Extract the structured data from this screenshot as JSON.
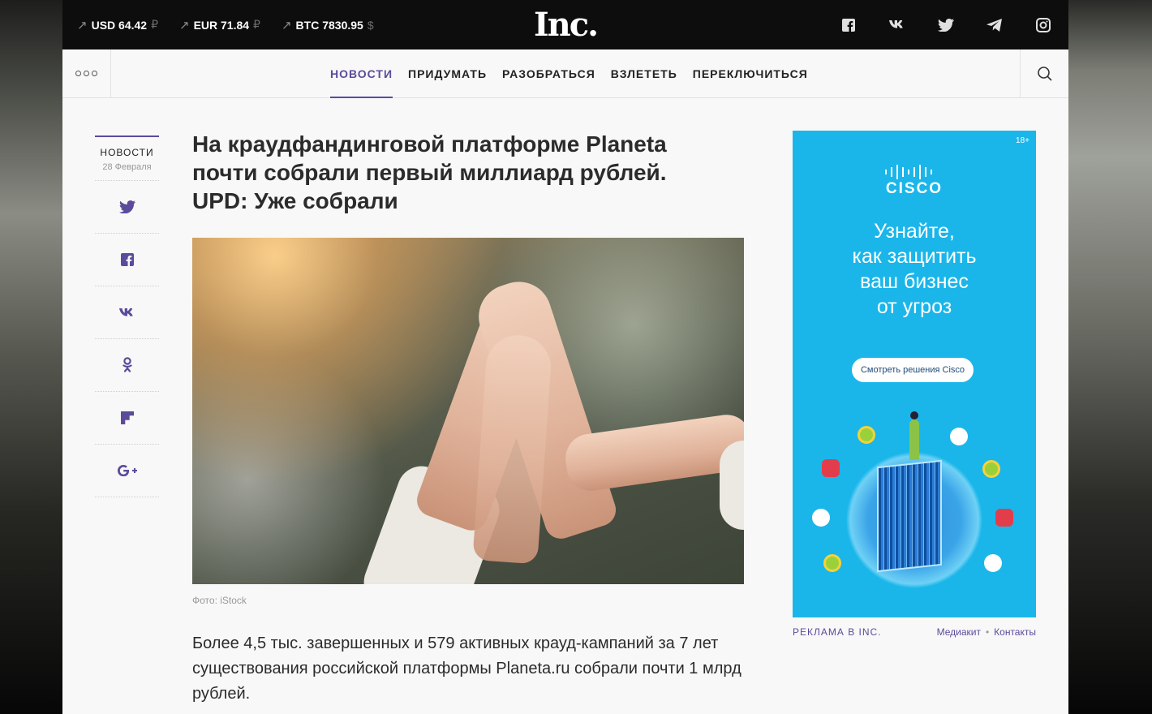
{
  "topbar": {
    "rates": [
      {
        "label": "USD 64.42",
        "currency": "₽"
      },
      {
        "label": "EUR 71.84",
        "currency": "₽"
      },
      {
        "label": "BTC 7830.95",
        "currency": "$"
      }
    ],
    "logo": "Inc.",
    "socials": [
      "facebook-icon",
      "vk-icon",
      "twitter-icon",
      "telegram-icon",
      "instagram-icon"
    ]
  },
  "nav": {
    "items": [
      "НОВОСТИ",
      "ПРИДУМАТЬ",
      "РАЗОБРАТЬСЯ",
      "ВЗЛЕТЕТЬ",
      "ПЕРЕКЛЮЧИТЬСЯ"
    ],
    "active_index": 0
  },
  "share": {
    "category": "НОВОСТИ",
    "date": "28 Февраля",
    "buttons": [
      "twitter-icon",
      "facebook-icon",
      "vk-icon",
      "odnoklassniki-icon",
      "flipboard-icon",
      "google-plus-icon"
    ]
  },
  "article": {
    "title": "На краудфандинговой платформе Planeta почти собрали первый миллиард рублей. UPD: Уже собрали",
    "photo_caption": "Фото: iStock",
    "lead": "Более 4,5 тыс. завершенных и 579 активных крауд-кампаний за 7 лет существования российской платформы Planeta.ru собрали почти 1 млрд рублей."
  },
  "ad": {
    "age": "18+",
    "brand": "CISCO",
    "text": "Узнайте,\nкак защитить\nваш бизнес\nот угроз",
    "button": "Смотреть решения Cisco",
    "background_color": "#1ab6ea",
    "footer_left": "РЕКЛАМА В INC.",
    "footer_links": [
      "Медиакит",
      "Контакты"
    ]
  },
  "colors": {
    "accent": "#5b4b9a",
    "topbar": "#0d0d0d"
  }
}
